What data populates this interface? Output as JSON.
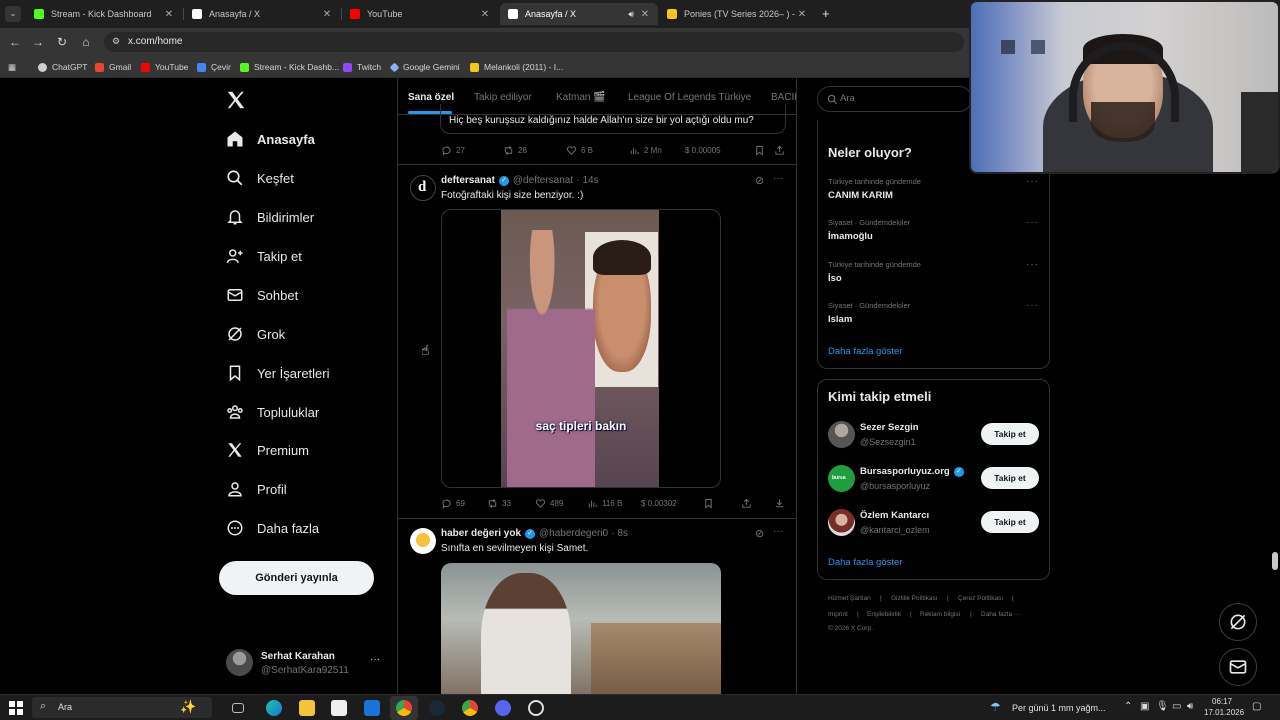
{
  "browser": {
    "tabs": [
      {
        "title": "Stream - Kick Dashboard",
        "favicon_color": "#53fc18"
      },
      {
        "title": "Anasayfa / X",
        "favicon_color": "#ffffff"
      },
      {
        "title": "YouTube",
        "favicon_color": "#ff0000"
      },
      {
        "title": "Anasayfa / X",
        "favicon_color": "#ffffff",
        "active": true
      },
      {
        "title": "Ponies (TV Series 2026– ) - IMDb",
        "favicon_color": "#f5c518"
      }
    ],
    "url": "x.com/home",
    "bookmarks": [
      {
        "label": "ChatGPT",
        "color": "#cfcfcf"
      },
      {
        "label": "Gmail",
        "color": "#ea4335"
      },
      {
        "label": "YouTube",
        "color": "#ff0000"
      },
      {
        "label": "Çevir",
        "color": "#4285f4"
      },
      {
        "label": "Stream - Kick Dashb...",
        "color": "#53fc18"
      },
      {
        "label": "Twitch",
        "color": "#9146ff"
      },
      {
        "label": "Google Gemini",
        "color": "#8ab4f8"
      },
      {
        "label": "Melankoli (2011) - I...",
        "color": "#f5c518"
      }
    ]
  },
  "sidebar": {
    "items": [
      {
        "label": "Anasayfa",
        "icon": "home-icon"
      },
      {
        "label": "Keşfet",
        "icon": "search-icon"
      },
      {
        "label": "Bildirimler",
        "icon": "bell-icon"
      },
      {
        "label": "Takip et",
        "icon": "follow-icon"
      },
      {
        "label": "Sohbet",
        "icon": "mail-icon"
      },
      {
        "label": "Grok",
        "icon": "grok-icon"
      },
      {
        "label": "Yer İşaretleri",
        "icon": "bookmark-icon"
      },
      {
        "label": "Topluluklar",
        "icon": "communities-icon"
      },
      {
        "label": "Premium",
        "icon": "x-logo-icon"
      },
      {
        "label": "Profil",
        "icon": "profile-icon"
      },
      {
        "label": "Daha fazla",
        "icon": "more-icon"
      }
    ],
    "post_button": "Gönderi yayınla",
    "account": {
      "name": "Serhat Karahan",
      "handle": "@SerhatKara92511"
    }
  },
  "feed": {
    "tabs": [
      "Sana özel",
      "Takip ediliyor",
      "Katman 🎬",
      "League Of Legends Türkiye",
      "BACIL"
    ],
    "quoted_text": "Hiç beş kuruşsuz kaldığınız halde Allah'ın size bir yol açtığı oldu mu?",
    "first_actions": {
      "replies": "27",
      "reposts": "28",
      "likes": "6 B",
      "views": "2 Mn",
      "earnings": "$ 0.00005"
    },
    "tweet1": {
      "name": "deftersanat",
      "handle": "@deftersanat",
      "time": "14s",
      "text": "Fotoğraftaki kişi size benziyor. :)",
      "video_caption": "saç tipleri bakın",
      "actions": {
        "replies": "69",
        "reposts": "33",
        "likes": "489",
        "views": "116 B",
        "earnings": "$ 0.00302"
      }
    },
    "tweet2": {
      "name": "haber değeri yok",
      "handle": "@haberdegeri0",
      "time": "8s",
      "text": "Sınıfta en sevilmeyen kişi Samet."
    }
  },
  "right": {
    "search_placeholder": "Ara",
    "trends_title": "Neler oluyor?",
    "trends": [
      {
        "meta": "Türkiye tarihinde gündemde",
        "name": "CANIM KARIM"
      },
      {
        "meta": "Siyaset · Gündemdekiler",
        "name": "İmamoğlu"
      },
      {
        "meta": "Türkiye tarihinde gündemde",
        "name": "İso"
      },
      {
        "meta": "Siyaset · Gündemdekiler",
        "name": "Islam"
      }
    ],
    "show_more": "Daha fazla göster",
    "who_title": "Kimi takip etmeli",
    "suggestions": [
      {
        "name": "Sezer Sezgin",
        "handle": "@Sezsezgin1",
        "verified": false
      },
      {
        "name": "Bursasporluyuz.org",
        "handle": "@bursasporluyuz",
        "verified": true
      },
      {
        "name": "Özlem Kantarcı",
        "handle": "@kantarci_ozlem",
        "verified": false
      }
    ],
    "follow_label": "Takip et",
    "footer": [
      "Hizmet Şartları",
      "Gizlilik Politikası",
      "Çerez Politikası",
      "Imprint",
      "Erişilebilirlik",
      "Reklam bilgisi",
      "Daha fazla ···",
      "© 2026 X Corp."
    ]
  },
  "taskbar": {
    "search": "Ara",
    "weather": "Per günü 1 mm yağm...",
    "time": "06:17",
    "date": "17.01.2026"
  }
}
